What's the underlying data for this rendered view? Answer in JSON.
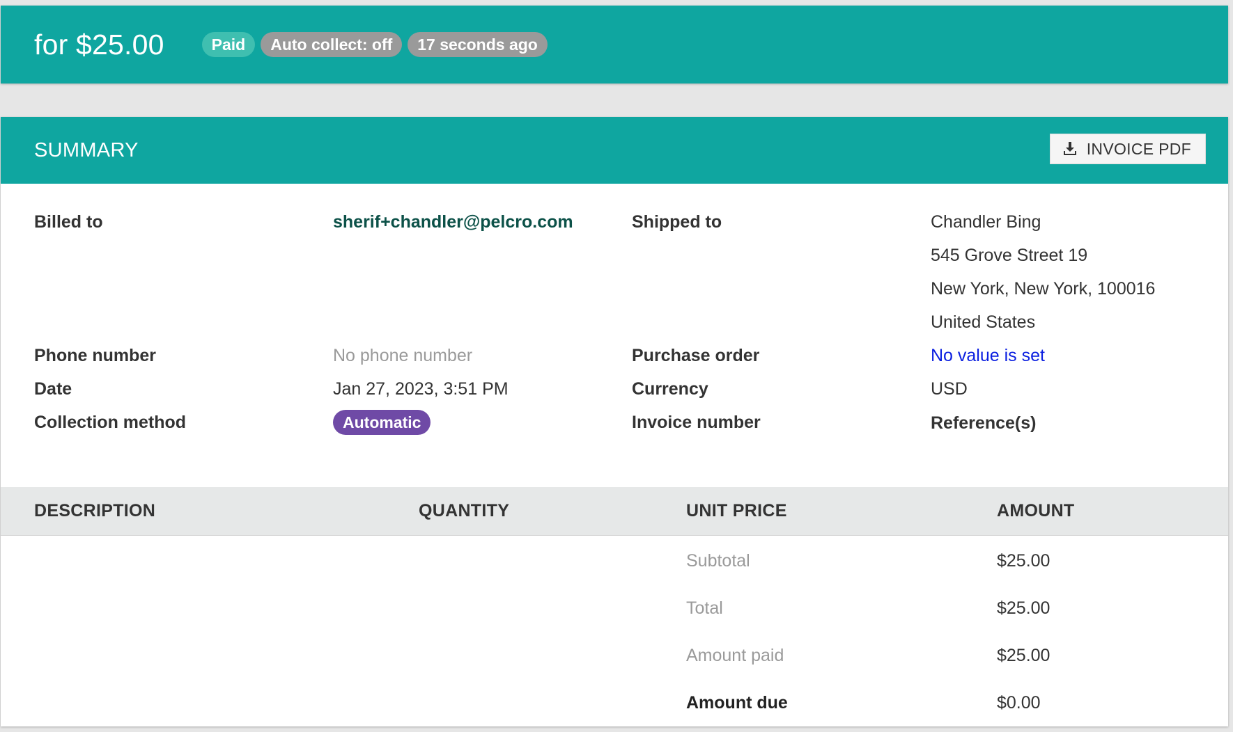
{
  "header": {
    "title": "for $25.00",
    "badges": {
      "status": "Paid",
      "auto_collect": "Auto collect: off",
      "time_ago": "17 seconds ago"
    }
  },
  "summary": {
    "title": "SUMMARY",
    "pdf_button_label": "INVOICE PDF",
    "pdf_icon": "download-icon",
    "fields": {
      "billed_to_label": "Billed to",
      "billed_to_value": "sherif+chandler@pelcro.com",
      "shipped_to_label": "Shipped to",
      "shipped_to_lines": [
        "Chandler Bing",
        "545 Grove Street 19",
        "New York, New York, 100016",
        "United States"
      ],
      "phone_label": "Phone number",
      "phone_value": "No phone number",
      "purchase_order_label": "Purchase order",
      "purchase_order_value": "No value is set",
      "date_label": "Date",
      "date_value": "Jan 27, 2023, 3:51 PM",
      "currency_label": "Currency",
      "currency_value": "USD",
      "collection_method_label": "Collection method",
      "collection_method_value": "Automatic",
      "invoice_number_label": "Invoice number",
      "references_label": "Reference(s)"
    },
    "table": {
      "columns": [
        "DESCRIPTION",
        "QUANTITY",
        "UNIT PRICE",
        "AMOUNT"
      ],
      "totals": [
        {
          "label": "Subtotal",
          "value": "$25.00"
        },
        {
          "label": "Total",
          "value": "$25.00"
        },
        {
          "label": "Amount paid",
          "value": "$25.00"
        },
        {
          "label": "Amount due",
          "value": "$0.00"
        }
      ]
    }
  },
  "colors": {
    "teal": "#0fa6a0",
    "paid_badge": "#3fbfb0",
    "grey_badge": "#9a9a9a",
    "purple_badge": "#6f4aa6",
    "link_blue": "#0b1fe0",
    "email_green": "#0c5148"
  }
}
